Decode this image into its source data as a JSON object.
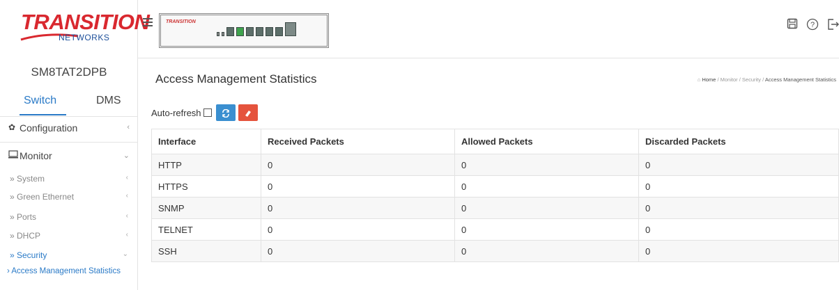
{
  "header": {
    "logo_main": "TRANSITION",
    "logo_sub": "NETWORKS",
    "device_brand": "TRANSITION",
    "icons": [
      "save-icon",
      "help-icon",
      "logout-icon"
    ]
  },
  "sidebar": {
    "model": "SM8TAT2DPB",
    "tabs": [
      {
        "label": "Switch",
        "active": true
      },
      {
        "label": "DMS",
        "active": false
      }
    ],
    "menu": [
      {
        "label": "Configuration",
        "icon": "gear-icon",
        "chevron": "‹"
      },
      {
        "label": "Monitor",
        "icon": "monitor-icon",
        "chevron": "⌄"
      }
    ],
    "submenu": [
      {
        "label": "» System",
        "chevron": "‹"
      },
      {
        "label": "» Green Ethernet",
        "chevron": "‹"
      },
      {
        "label": "» Ports",
        "chevron": "‹"
      },
      {
        "label": "» DHCP",
        "chevron": "‹"
      },
      {
        "label": "» Security",
        "chevron": "⌄"
      }
    ],
    "active_leaf": "› Access Management Statistics"
  },
  "main": {
    "title": "Access Management Statistics",
    "breadcrumb": {
      "home": "Home",
      "items": [
        "Monitor",
        "Security"
      ],
      "current": "Access Management Statistics"
    },
    "auto_refresh_label": "Auto-refresh",
    "auto_refresh_checked": false,
    "table": {
      "columns": [
        "Interface",
        "Received Packets",
        "Allowed Packets",
        "Discarded Packets"
      ],
      "rows": [
        [
          "HTTP",
          "0",
          "0",
          "0"
        ],
        [
          "HTTPS",
          "0",
          "0",
          "0"
        ],
        [
          "SNMP",
          "0",
          "0",
          "0"
        ],
        [
          "TELNET",
          "0",
          "0",
          "0"
        ],
        [
          "SSH",
          "0",
          "0",
          "0"
        ]
      ]
    }
  },
  "colors": {
    "accent": "#2a7ac7",
    "logo_red": "#d9282f",
    "refresh_button": "#3a8fd0",
    "clear_button": "#e5533d"
  }
}
